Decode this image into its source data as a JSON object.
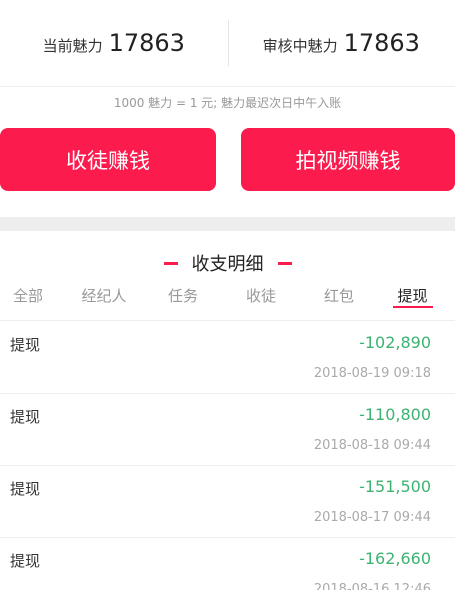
{
  "stats": {
    "current_label": "当前魅力",
    "current_value": "17863",
    "review_label": "审核中魅力",
    "review_value": "17863"
  },
  "note": "1000 魅力 = 1 元; 魅力最迟次日中午入账",
  "buttons": {
    "recruit": "收徒赚钱",
    "video": "拍视频赚钱"
  },
  "section_title": "收支明细",
  "tabs": [
    {
      "label": "全部",
      "active": false
    },
    {
      "label": "经纪人",
      "active": false
    },
    {
      "label": "任务",
      "active": false
    },
    {
      "label": "收徒",
      "active": false
    },
    {
      "label": "红包",
      "active": false
    },
    {
      "label": "提现",
      "active": true
    }
  ],
  "records": [
    {
      "type": "提现",
      "amount": "-102,890",
      "time": "2018-08-19 09:18"
    },
    {
      "type": "提现",
      "amount": "-110,800",
      "time": "2018-08-18 09:44"
    },
    {
      "type": "提现",
      "amount": "-151,500",
      "time": "2018-08-17 09:44"
    },
    {
      "type": "提现",
      "amount": "-162,660",
      "time": "2018-08-16 12:46"
    }
  ],
  "colors": {
    "accent": "#fb1b4c",
    "amount": "#3cb371"
  }
}
